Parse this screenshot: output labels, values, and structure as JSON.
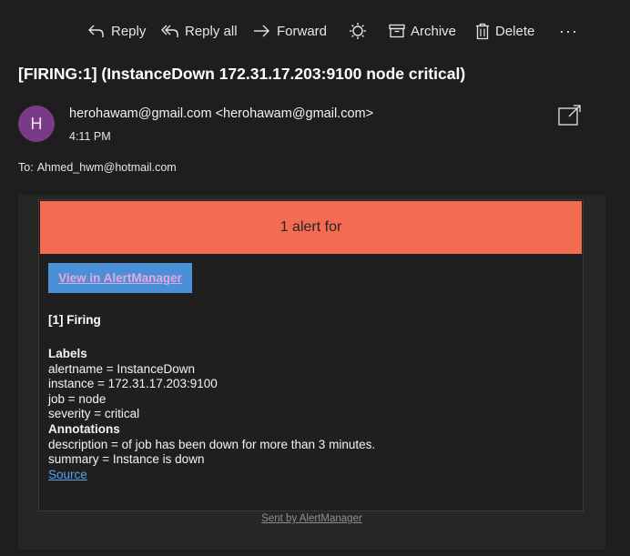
{
  "toolbar": {
    "reply": "Reply",
    "reply_all": "Reply all",
    "forward": "Forward",
    "archive": "Archive",
    "delete": "Delete",
    "more": "···"
  },
  "message": {
    "subject": "[FIRING:1]  (InstanceDown 172.31.17.203:9100 node critical)",
    "avatar_initial": "H",
    "sender": "herohawam@gmail.com <herohawam@gmail.com>",
    "time": "4:11 PM",
    "to_label": "To:",
    "to_value": "Ahmed_hwm@hotmail.com"
  },
  "alert": {
    "banner": "1 alert for",
    "button": "View in AlertManager",
    "firing_heading": "[1] Firing",
    "labels_heading": "Labels",
    "labels": [
      "alertname = InstanceDown",
      "instance = 172.31.17.203:9100",
      "job = node",
      "severity = critical"
    ],
    "annotations_heading": "Annotations",
    "annotations": [
      "description = of job has been down for more than 3 minutes.",
      "summary = Instance is down"
    ],
    "source_link": "Source",
    "footer": "Sent by AlertManager"
  },
  "colors": {
    "background": "#1e1e1e",
    "banner": "#f36b50",
    "button": "#4a90d9",
    "link": "#5aa3ef",
    "avatar": "#7a3a86"
  }
}
